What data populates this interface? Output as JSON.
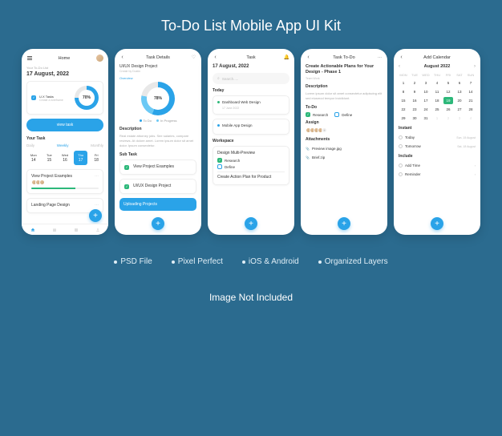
{
  "title": "To-Do List Mobile App UI Kit",
  "features": [
    "PSD File",
    "Pixel Perfect",
    "iOS & Android",
    "Organized Layers"
  ],
  "footer": "Image Not Included",
  "accent": "#2aa3e8",
  "green": "#2db87a",
  "s1": {
    "title": "Home",
    "label": "Your To-Do List",
    "date": "17 August, 2022",
    "task_name": "U.X Tasks",
    "task_sub": "Create a wireframe",
    "pct": "70%",
    "btn": "view task",
    "section": "Your Task",
    "tabs": [
      "Daily",
      "Weekly",
      "Monthly"
    ],
    "days": [
      {
        "d": "Mon",
        "n": "14"
      },
      {
        "d": "Tue",
        "n": "15"
      },
      {
        "d": "Wed",
        "n": "16"
      },
      {
        "d": "Thu",
        "n": "17"
      },
      {
        "d": "Fri",
        "n": "18"
      }
    ],
    "p1": "View Project Examples",
    "p2": "Landing Page Design"
  },
  "s2": {
    "title": "Task Details",
    "project": "UI/UX Design Project",
    "by": "Create by Dustin",
    "pct": "78%",
    "leg1": "To Do",
    "leg2": "In Progress",
    "overview": "Overview",
    "desc_h": "Description",
    "desc": "Real estate attorney jobs. See salaries, compare reviews. At dolore amet. Lorem ipsum dolor sit amet dolor. Ipsum consectetur.",
    "sub_h": "Sub Task",
    "t1": "View Project Examples",
    "t2": "UI/UX Design Project",
    "t3": "Uploading Projects"
  },
  "s3": {
    "title": "Task",
    "date": "17 August, 2022",
    "search": "Search.....",
    "today": "Today",
    "t1": "Dashboard Web Design",
    "d1": "17 June 2022",
    "t2": "Mobile App Design",
    "ws": "Workspace",
    "w1": "Design Multi-Preview",
    "w2": "Research",
    "w3": "Define",
    "cap": "Create Action Plan for Product"
  },
  "s4": {
    "title": "Task To-Do",
    "big": "Create Actionable Plans for Your Design - Phase 1",
    "team": "Team Work",
    "desc_h": "Description",
    "desc": "Lorem ipsum dolor sit amet consectetur adipiscing elit sed eiusmod tempor incididunt.",
    "todo_h": "To-Do",
    "td1": "Research",
    "td2": "Define",
    "assign": "Assign",
    "attach_h": "Attachments",
    "a1": "Preview image.jpg",
    "a2": "Brief.zip"
  },
  "s5": {
    "title": "Add Calendar",
    "month": "August 2022",
    "dows": [
      "MON",
      "TUE",
      "WED",
      "THU",
      "FRI",
      "SAT",
      "SUN"
    ],
    "cells": [
      "1",
      "2",
      "3",
      "4",
      "5",
      "6",
      "7",
      "8",
      "9",
      "10",
      "11",
      "12",
      "13",
      "14",
      "15",
      "16",
      "17",
      "18",
      "19",
      "20",
      "21",
      "22",
      "23",
      "24",
      "25",
      "26",
      "27",
      "28",
      "29",
      "30",
      "31",
      "1",
      "2",
      "3",
      "4"
    ],
    "highlighted": "19",
    "instant_h": "Instant",
    "i1": "Today",
    "i1r": "Sun, 15 August",
    "i2": "Tomorrow",
    "i2r": "Sat, 18 August",
    "include_h": "Include",
    "c1": "Add Time",
    "c2": "Reminder"
  }
}
